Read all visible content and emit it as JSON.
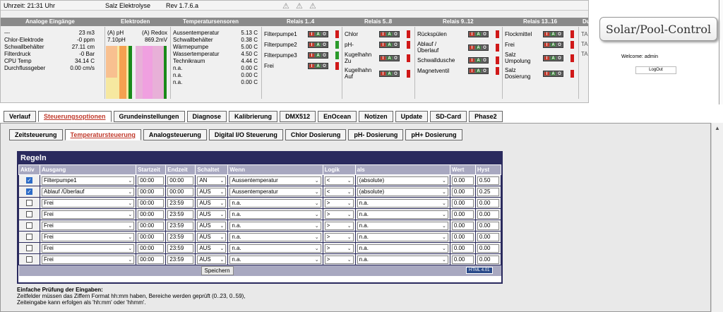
{
  "status": {
    "time": "Uhrzeit: 21:31 Uhr",
    "system": "Salz Elektrolyse",
    "rev": "Rev 1.7.6.a"
  },
  "icons": [
    "warning-icon",
    "warning-icon",
    "warning-icon"
  ],
  "headers": [
    "Analoge Eingänge",
    "Elektroden",
    "Temperatursensoren",
    "Relais 1..4",
    "Relais 5..8",
    "Relais 9..12",
    "Relais 13..16",
    "Du"
  ],
  "analog": [
    {
      "name": "---",
      "value": "23 m3"
    },
    {
      "name": "Chlor-Elektrode",
      "value": "-0 ppm"
    },
    {
      "name": "Schwallbehälter",
      "value": "27.11 cm"
    },
    {
      "name": "Filterdruck",
      "value": "-0 Bar"
    },
    {
      "name": "CPU Temp",
      "value": "34.14 C"
    },
    {
      "name": "Durchflussgeber",
      "value": "0.00 cm/s"
    }
  ],
  "electrodes": {
    "ph_label": "(A) pH",
    "ph_value": "7.10pH",
    "redox_label": "(A) Redox",
    "redox_value": "869.2mV"
  },
  "temps": [
    {
      "name": "Aussentemperatur",
      "value": "5.13 C"
    },
    {
      "name": "Schwallbehälter",
      "value": "0.38 C"
    },
    {
      "name": "Wärmepumpe",
      "value": "5.00 C"
    },
    {
      "name": "Wassertemperatur",
      "value": "4.50 C"
    },
    {
      "name": "Technikraum",
      "value": "4.44 C"
    },
    {
      "name": "n.a.",
      "value": "0.00 C"
    },
    {
      "name": "n.a.",
      "value": "0.00 C"
    },
    {
      "name": "n.a.",
      "value": "0.00 C"
    }
  ],
  "relais1": [
    "Filterpumpe1",
    "Filterpumpe2",
    "Filterpumpe3",
    "Frei"
  ],
  "relais2": [
    "Chlor",
    "pH-",
    "Kugelhahn Zu",
    "Kugelhahn Auf"
  ],
  "relais3": [
    "Rückspülen",
    "Ablauf /Überlauf",
    "Schwalldusche",
    "Magnetventil"
  ],
  "relais4": [
    "Flockmittel",
    "Frei",
    "Salz Umpolung",
    "Salz Dosierung"
  ],
  "iao": {
    "i": "I",
    "a": "A",
    "o": "O"
  },
  "du": [
    "Du",
    "TA",
    "TA",
    "TA"
  ],
  "logo": "Solar/Pool-Control",
  "welcome": "Welcome:  admin",
  "logout": "LogOut",
  "tabs": [
    "Verlauf",
    "Steuerungsoptionen",
    "Grundeinstellungen",
    "Diagnose",
    "Kalibrierung",
    "DMX512",
    "EnOcean",
    "Notizen",
    "Update",
    "SD-Card",
    "Phase2"
  ],
  "subtabs": [
    "Zeitsteuerung",
    "Temperatursteuerung",
    "Analogsteuerung",
    "Digital I/O Steuerung",
    "Chlor Dosierung",
    "pH- Dosierung",
    "pH+ Dosierung"
  ],
  "rules_title": "Regeln",
  "columns": [
    "Aktiv",
    "Ausgang",
    "Startzeit",
    "Endzeit",
    "Schaltet",
    "Wenn",
    "Logik",
    "als",
    "Wert",
    "Hyst"
  ],
  "rows": [
    {
      "aktiv": true,
      "ausgang": "Filterpumpe1",
      "start": "00:00",
      "end": "00:00",
      "schaltet": "AN",
      "wenn": "Aussentemperatur",
      "logik": "<",
      "als": "(absolute)",
      "wert": "0.00",
      "hyst": "0.50"
    },
    {
      "aktiv": true,
      "ausgang": "Ablauf /Überlauf",
      "start": "00:00",
      "end": "00:00",
      "schaltet": "AUS",
      "wenn": "Aussentemperatur",
      "logik": "<",
      "als": "(absolute)",
      "wert": "0.00",
      "hyst": "0.25"
    },
    {
      "aktiv": false,
      "ausgang": "Frei",
      "start": "00:00",
      "end": "23:59",
      "schaltet": "AUS",
      "wenn": "n.a.",
      "logik": ">",
      "als": "n.a.",
      "wert": "0.00",
      "hyst": "0.00"
    },
    {
      "aktiv": false,
      "ausgang": "Frei",
      "start": "00:00",
      "end": "23:59",
      "schaltet": "AUS",
      "wenn": "n.a.",
      "logik": ">",
      "als": "n.a.",
      "wert": "0.00",
      "hyst": "0.00"
    },
    {
      "aktiv": false,
      "ausgang": "Frei",
      "start": "00:00",
      "end": "23:59",
      "schaltet": "AUS",
      "wenn": "n.a.",
      "logik": ">",
      "als": "n.a.",
      "wert": "0.00",
      "hyst": "0.00"
    },
    {
      "aktiv": false,
      "ausgang": "Frei",
      "start": "00:00",
      "end": "23:59",
      "schaltet": "AUS",
      "wenn": "n.a.",
      "logik": ">",
      "als": "n.a.",
      "wert": "0.00",
      "hyst": "0.00"
    },
    {
      "aktiv": false,
      "ausgang": "Frei",
      "start": "00:00",
      "end": "23:59",
      "schaltet": "AUS",
      "wenn": "n.a.",
      "logik": ">",
      "als": "n.a.",
      "wert": "0.00",
      "hyst": "0.00"
    },
    {
      "aktiv": false,
      "ausgang": "Frei",
      "start": "00:00",
      "end": "23:59",
      "schaltet": "AUS",
      "wenn": "n.a.",
      "logik": ">",
      "als": "n.a.",
      "wert": "0.00",
      "hyst": "0.00"
    }
  ],
  "save": "Speichern",
  "badge": "HTML 4.01",
  "help": {
    "title": "Einfache Prüfung der Eingaben:",
    "line1": "Zeitfelder müssen das Ziffern Format hh:mm haben, Bereiche werden geprüft (0..23, 0..59),",
    "line2": "Zeiteingabe kann erfolgen als 'hh:mm' oder 'hhmm'."
  }
}
